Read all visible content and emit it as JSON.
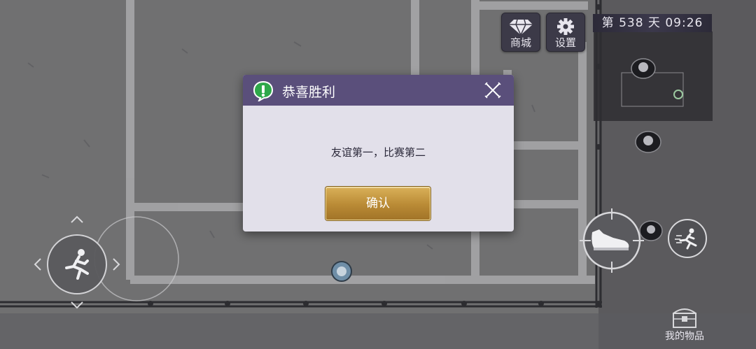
{
  "hud": {
    "shop_label": "商城",
    "settings_label": "设置",
    "day_clock": "第 538 天  09:26"
  },
  "dialog": {
    "title": "恭喜胜利",
    "message": "友谊第一，比赛第二",
    "confirm_label": "确认"
  },
  "inventory": {
    "label": "我的物品"
  },
  "icons": {
    "shop": "diamond-icon",
    "settings": "gear-icon",
    "dialog": "exclamation-bubble-icon",
    "close": "close-icon",
    "sprint": "running-man-icon",
    "kick": "shoe-icon",
    "dodge": "runner-icon",
    "inventory": "chest-icon"
  },
  "colors": {
    "dialog_header": "#5a4f7b",
    "dialog_body": "#e2e0ea",
    "confirm_gold": "#c69a42",
    "hud_bg": "#3c3a48"
  }
}
